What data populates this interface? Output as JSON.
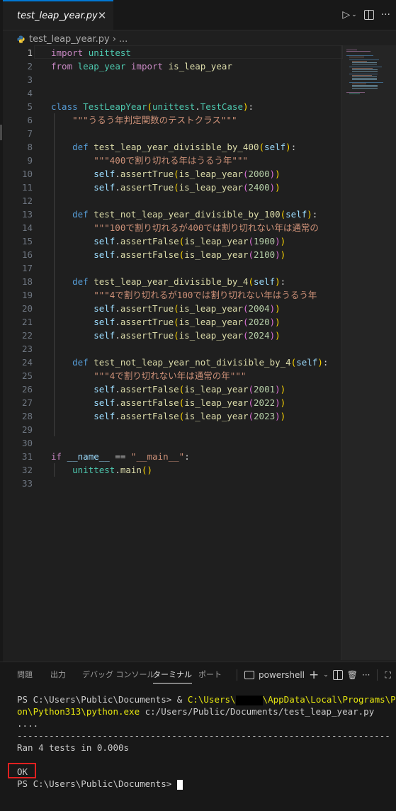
{
  "tab": {
    "label": "test_leap_year.py",
    "close_glyph": "✕"
  },
  "tab_actions": {
    "run_glyph": "▷",
    "chevron_glyph": "⌄",
    "more_glyph": "···"
  },
  "breadcrumb": {
    "file": "test_leap_year.py",
    "sep": "›",
    "more": "..."
  },
  "code_lines": [
    [
      [
        "kw2",
        "import"
      ],
      [
        "op",
        " "
      ],
      [
        "cls",
        "unittest"
      ]
    ],
    [
      [
        "kw2",
        "from"
      ],
      [
        "op",
        " "
      ],
      [
        "cls",
        "leap_year"
      ],
      [
        "op",
        " "
      ],
      [
        "kw2",
        "import"
      ],
      [
        "op",
        " "
      ],
      [
        "fn",
        "is_leap_year"
      ]
    ],
    [],
    [],
    [
      [
        "kw",
        "class"
      ],
      [
        "op",
        " "
      ],
      [
        "cls",
        "TestLeapYear"
      ],
      [
        "p1",
        "("
      ],
      [
        "cls",
        "unittest"
      ],
      [
        "op",
        "."
      ],
      [
        "cls",
        "TestCase"
      ],
      [
        "p1",
        ")"
      ],
      [
        "op",
        ":"
      ]
    ],
    [
      [
        "str",
        "    \"\"\"うるう年判定関数のテストクラス\"\"\""
      ]
    ],
    [],
    [
      [
        "op",
        "    "
      ],
      [
        "kw",
        "def"
      ],
      [
        "op",
        " "
      ],
      [
        "fn",
        "test_leap_year_divisible_by_400"
      ],
      [
        "p1",
        "("
      ],
      [
        "var",
        "self"
      ],
      [
        "p1",
        ")"
      ],
      [
        "op",
        ":"
      ]
    ],
    [
      [
        "str",
        "        \"\"\"400で割り切れる年はうるう年\"\"\""
      ]
    ],
    [
      [
        "op",
        "        "
      ],
      [
        "var",
        "self"
      ],
      [
        "op",
        "."
      ],
      [
        "fn",
        "assertTrue"
      ],
      [
        "p1",
        "("
      ],
      [
        "fn",
        "is_leap_year"
      ],
      [
        "p2",
        "("
      ],
      [
        "num",
        "2000"
      ],
      [
        "p2",
        ")"
      ],
      [
        "p1",
        ")"
      ]
    ],
    [
      [
        "op",
        "        "
      ],
      [
        "var",
        "self"
      ],
      [
        "op",
        "."
      ],
      [
        "fn",
        "assertTrue"
      ],
      [
        "p1",
        "("
      ],
      [
        "fn",
        "is_leap_year"
      ],
      [
        "p2",
        "("
      ],
      [
        "num",
        "2400"
      ],
      [
        "p2",
        ")"
      ],
      [
        "p1",
        ")"
      ]
    ],
    [],
    [
      [
        "op",
        "    "
      ],
      [
        "kw",
        "def"
      ],
      [
        "op",
        " "
      ],
      [
        "fn",
        "test_not_leap_year_divisible_by_100"
      ],
      [
        "p1",
        "("
      ],
      [
        "var",
        "self"
      ],
      [
        "p1",
        ")"
      ],
      [
        "op",
        ":"
      ]
    ],
    [
      [
        "str",
        "        \"\"\"100で割り切れるが400では割り切れない年は通常の"
      ]
    ],
    [
      [
        "op",
        "        "
      ],
      [
        "var",
        "self"
      ],
      [
        "op",
        "."
      ],
      [
        "fn",
        "assertFalse"
      ],
      [
        "p1",
        "("
      ],
      [
        "fn",
        "is_leap_year"
      ],
      [
        "p2",
        "("
      ],
      [
        "num",
        "1900"
      ],
      [
        "p2",
        ")"
      ],
      [
        "p1",
        ")"
      ]
    ],
    [
      [
        "op",
        "        "
      ],
      [
        "var",
        "self"
      ],
      [
        "op",
        "."
      ],
      [
        "fn",
        "assertFalse"
      ],
      [
        "p1",
        "("
      ],
      [
        "fn",
        "is_leap_year"
      ],
      [
        "p2",
        "("
      ],
      [
        "num",
        "2100"
      ],
      [
        "p2",
        ")"
      ],
      [
        "p1",
        ")"
      ]
    ],
    [],
    [
      [
        "op",
        "    "
      ],
      [
        "kw",
        "def"
      ],
      [
        "op",
        " "
      ],
      [
        "fn",
        "test_leap_year_divisible_by_4"
      ],
      [
        "p1",
        "("
      ],
      [
        "var",
        "self"
      ],
      [
        "p1",
        ")"
      ],
      [
        "op",
        ":"
      ]
    ],
    [
      [
        "str",
        "        \"\"\"4で割り切れるが100では割り切れない年はうるう年"
      ]
    ],
    [
      [
        "op",
        "        "
      ],
      [
        "var",
        "self"
      ],
      [
        "op",
        "."
      ],
      [
        "fn",
        "assertTrue"
      ],
      [
        "p1",
        "("
      ],
      [
        "fn",
        "is_leap_year"
      ],
      [
        "p2",
        "("
      ],
      [
        "num",
        "2004"
      ],
      [
        "p2",
        ")"
      ],
      [
        "p1",
        ")"
      ]
    ],
    [
      [
        "op",
        "        "
      ],
      [
        "var",
        "self"
      ],
      [
        "op",
        "."
      ],
      [
        "fn",
        "assertTrue"
      ],
      [
        "p1",
        "("
      ],
      [
        "fn",
        "is_leap_year"
      ],
      [
        "p2",
        "("
      ],
      [
        "num",
        "2020"
      ],
      [
        "p2",
        ")"
      ],
      [
        "p1",
        ")"
      ]
    ],
    [
      [
        "op",
        "        "
      ],
      [
        "var",
        "self"
      ],
      [
        "op",
        "."
      ],
      [
        "fn",
        "assertTrue"
      ],
      [
        "p1",
        "("
      ],
      [
        "fn",
        "is_leap_year"
      ],
      [
        "p2",
        "("
      ],
      [
        "num",
        "2024"
      ],
      [
        "p2",
        ")"
      ],
      [
        "p1",
        ")"
      ]
    ],
    [],
    [
      [
        "op",
        "    "
      ],
      [
        "kw",
        "def"
      ],
      [
        "op",
        " "
      ],
      [
        "fn",
        "test_not_leap_year_not_divisible_by_4"
      ],
      [
        "p1",
        "("
      ],
      [
        "var",
        "self"
      ],
      [
        "p1",
        ")"
      ],
      [
        "op",
        ":"
      ]
    ],
    [
      [
        "str",
        "        \"\"\"4で割り切れない年は通常の年\"\"\""
      ]
    ],
    [
      [
        "op",
        "        "
      ],
      [
        "var",
        "self"
      ],
      [
        "op",
        "."
      ],
      [
        "fn",
        "assertFalse"
      ],
      [
        "p1",
        "("
      ],
      [
        "fn",
        "is_leap_year"
      ],
      [
        "p2",
        "("
      ],
      [
        "num",
        "2001"
      ],
      [
        "p2",
        ")"
      ],
      [
        "p1",
        ")"
      ]
    ],
    [
      [
        "op",
        "        "
      ],
      [
        "var",
        "self"
      ],
      [
        "op",
        "."
      ],
      [
        "fn",
        "assertFalse"
      ],
      [
        "p1",
        "("
      ],
      [
        "fn",
        "is_leap_year"
      ],
      [
        "p2",
        "("
      ],
      [
        "num",
        "2022"
      ],
      [
        "p2",
        ")"
      ],
      [
        "p1",
        ")"
      ]
    ],
    [
      [
        "op",
        "        "
      ],
      [
        "var",
        "self"
      ],
      [
        "op",
        "."
      ],
      [
        "fn",
        "assertFalse"
      ],
      [
        "p1",
        "("
      ],
      [
        "fn",
        "is_leap_year"
      ],
      [
        "p2",
        "("
      ],
      [
        "num",
        "2023"
      ],
      [
        "p2",
        ")"
      ],
      [
        "p1",
        ")"
      ]
    ],
    [],
    [],
    [
      [
        "kw2",
        "if"
      ],
      [
        "op",
        " "
      ],
      [
        "var",
        "__name__"
      ],
      [
        "op",
        " == "
      ],
      [
        "str",
        "\"__main__\""
      ],
      [
        "op",
        ":"
      ]
    ],
    [
      [
        "op",
        "    "
      ],
      [
        "cls",
        "unittest"
      ],
      [
        "op",
        "."
      ],
      [
        "fn",
        "main"
      ],
      [
        "p1",
        "()"
      ]
    ],
    []
  ],
  "panel": {
    "tabs": [
      "問題",
      "出力",
      "デバッグ コンソール",
      "ターミナル",
      "ポート"
    ],
    "terminal_name": "powershell",
    "add_glyph": "+",
    "chevron_glyph": "⌄",
    "trash_glyph": "🗑",
    "more_glyph": "···",
    "maximize_glyph": "⛶"
  },
  "terminal": {
    "line1_prefix": "PS C:\\Users\\Public\\Documents> & ",
    "line1_path": "C:\\Users\\",
    "line1_path2": "\\AppData\\Local\\Programs\\Pyth",
    "line2_path": "on\\Python313\\python.exe",
    "line2_rest": " c:/Users/Public/Documents/test_leap_year.py",
    "line3": "....",
    "line4": "----------------------------------------------------------------------",
    "line5": "Ran 4 tests in 0.000s",
    "line6": "",
    "line7": "OK",
    "line8": "PS C:\\Users\\Public\\Documents> "
  }
}
